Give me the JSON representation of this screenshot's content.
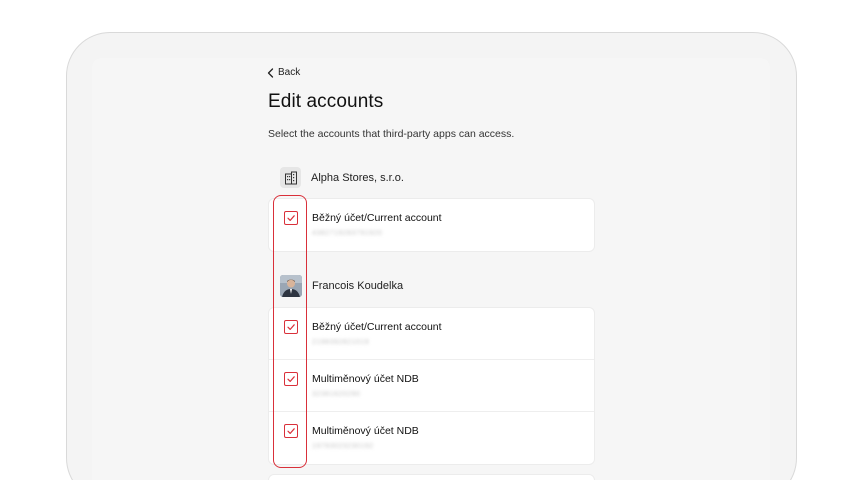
{
  "nav": {
    "back_label": "Back"
  },
  "page": {
    "title": "Edit accounts",
    "subtitle": "Select the accounts that third-party apps can access."
  },
  "groups": [
    {
      "name": "Alpha Stores, s.r.o.",
      "icon": "building-icon",
      "accounts": [
        {
          "name": "Běžný účet/Current account",
          "number": "4382719283791920",
          "checked": true
        }
      ]
    },
    {
      "name": "Francois Koudelka",
      "icon": "avatar",
      "accounts": [
        {
          "name": "Běžný účet/Current account",
          "number": "2198392821019",
          "checked": true
        },
        {
          "name": "Multiměnový účet NDB",
          "number": "32381620290",
          "checked": true
        },
        {
          "name": "Multiměnový účet NDB",
          "number": "19793023230192",
          "checked": true
        }
      ]
    }
  ],
  "colors": {
    "accent": "#d9303a",
    "background": "#f6f6f6",
    "card": "#ffffff"
  }
}
